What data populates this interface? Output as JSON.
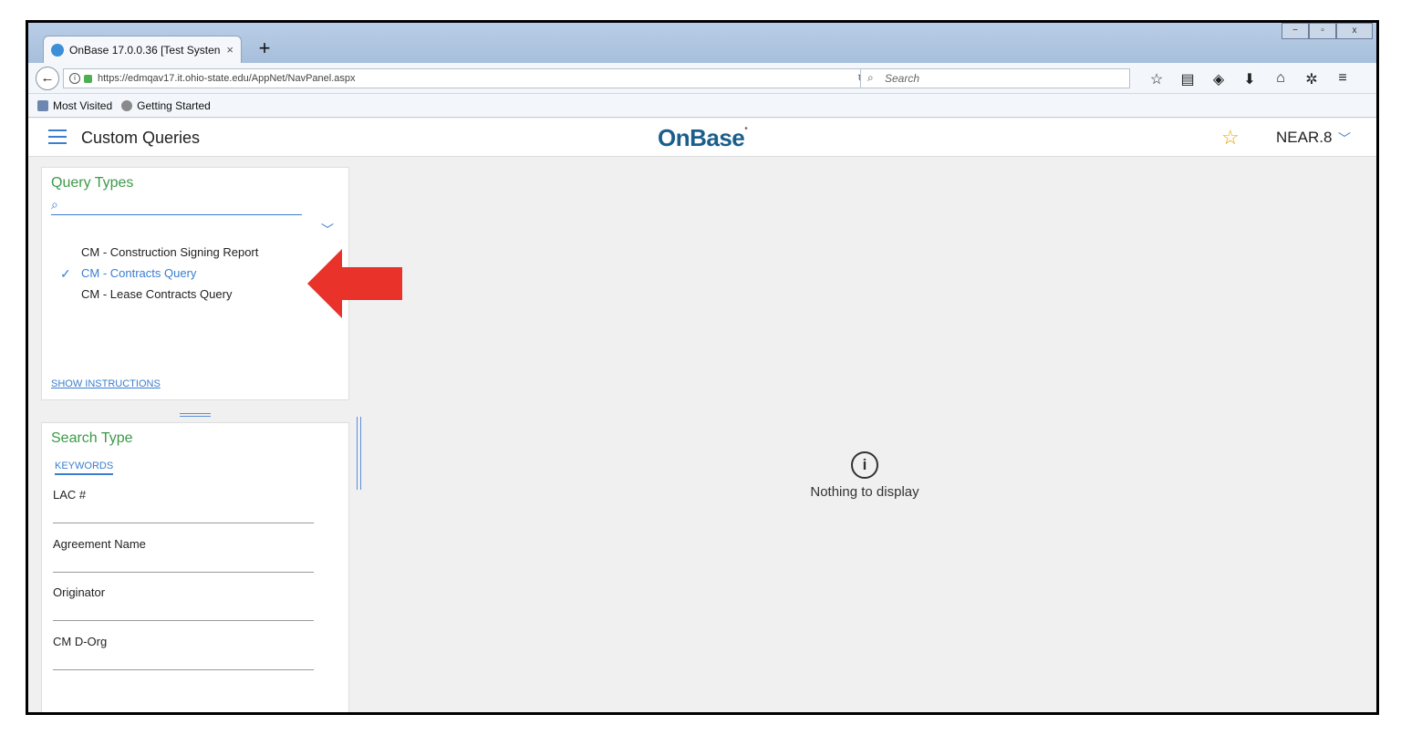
{
  "browser": {
    "tab_title": "OnBase 17.0.0.36 [Test Systen",
    "tab_close": "×",
    "new_tab": "+",
    "window_controls": [
      "−",
      "▫",
      "x"
    ],
    "url": "https://edmqav17.it.ohio-state.edu/AppNet/NavPanel.aspx",
    "search_placeholder": "Search",
    "toolbar_icons": [
      "☆",
      "▤",
      "◈",
      "⬇",
      "⌂",
      "✲",
      "≡"
    ],
    "bookmarks": [
      "Most Visited",
      "Getting Started"
    ]
  },
  "header": {
    "title": "Custom Queries",
    "logo": "OnBase",
    "user": "NEAR.8"
  },
  "query_types": {
    "title": "Query Types",
    "items": [
      {
        "label": "CM - Construction Signing Report",
        "selected": false
      },
      {
        "label": "CM - Contracts Query",
        "selected": true
      },
      {
        "label": "CM - Lease Contracts Query",
        "selected": false
      }
    ],
    "show_instructions": "SHOW INSTRUCTIONS"
  },
  "search_type": {
    "title": "Search Type",
    "tab": "KEYWORDS",
    "fields": [
      "LAC #",
      "Agreement Name",
      "Originator",
      "CM D-Org"
    ]
  },
  "main": {
    "empty_message": "Nothing to display"
  },
  "colors": {
    "accent_blue": "#3a7dd1",
    "section_green": "#3c9a47",
    "annotation_red": "#e8322a"
  }
}
